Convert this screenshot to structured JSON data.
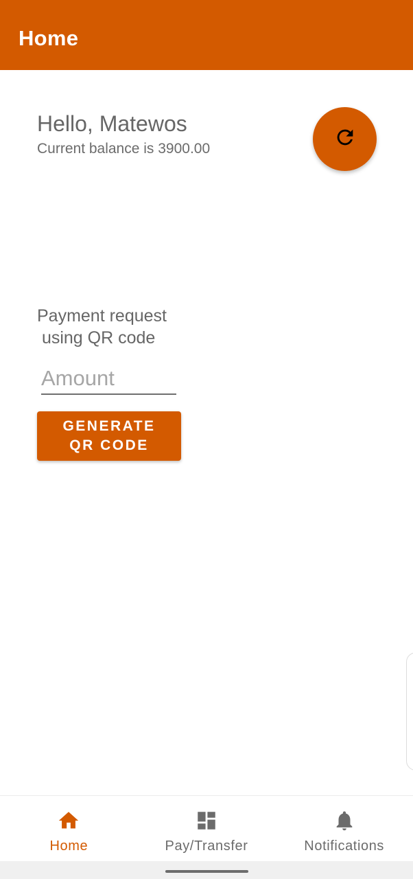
{
  "app_bar": {
    "title": "Home"
  },
  "account": {
    "greeting": "Hello, Matewos",
    "balance_text": "Current balance is 3900.00"
  },
  "refresh_button": {
    "icon": "refresh-icon"
  },
  "qr_request": {
    "label": "Payment request\n using QR code",
    "amount_placeholder": "Amount",
    "amount_value": "",
    "button_line1": "GENERATE",
    "button_line2": "QR CODE"
  },
  "bottom_nav": {
    "items": [
      {
        "label": "Home",
        "icon": "home-icon",
        "active": true
      },
      {
        "label": "Pay/Transfer",
        "icon": "dashboard-icon",
        "active": false
      },
      {
        "label": "Notifications",
        "icon": "bell-icon",
        "active": false
      }
    ]
  },
  "colors": {
    "primary": "#d35a00",
    "text_gray": "#666666",
    "nav_inactive": "#6b6b6b"
  }
}
